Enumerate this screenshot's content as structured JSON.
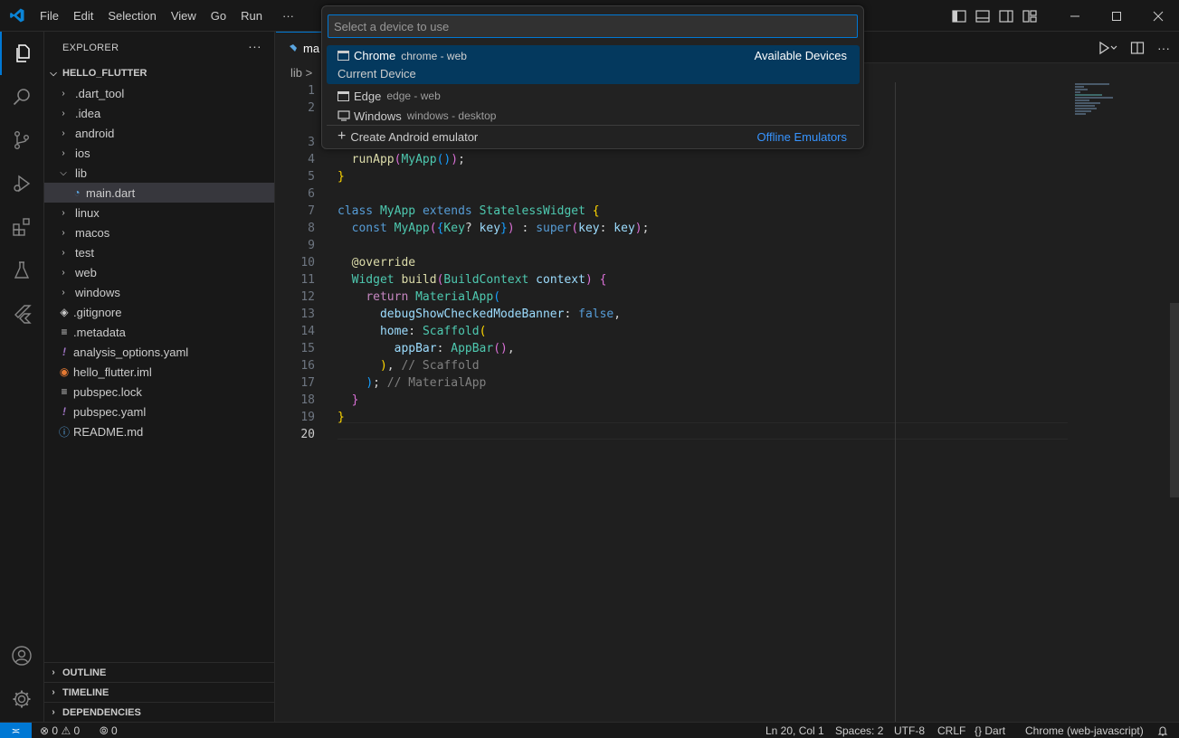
{
  "menu": [
    "File",
    "Edit",
    "Selection",
    "View",
    "Go",
    "Run",
    "···"
  ],
  "explorer": {
    "title": "EXPLORER",
    "more": "···",
    "project": "HELLO_FLUTTER",
    "items": [
      {
        "label": ".dart_tool",
        "kind": "folder"
      },
      {
        "label": ".idea",
        "kind": "folder"
      },
      {
        "label": "android",
        "kind": "folder"
      },
      {
        "label": "ios",
        "kind": "folder"
      },
      {
        "label": "lib",
        "kind": "folder-open"
      },
      {
        "label": "main.dart",
        "kind": "dart"
      },
      {
        "label": "linux",
        "kind": "folder"
      },
      {
        "label": "macos",
        "kind": "folder"
      },
      {
        "label": "test",
        "kind": "folder"
      },
      {
        "label": "web",
        "kind": "folder"
      },
      {
        "label": "windows",
        "kind": "folder"
      },
      {
        "label": ".gitignore",
        "kind": "git"
      },
      {
        "label": ".metadata",
        "kind": "lines"
      },
      {
        "label": "analysis_options.yaml",
        "kind": "yaml"
      },
      {
        "label": "hello_flutter.iml",
        "kind": "rss"
      },
      {
        "label": "pubspec.lock",
        "kind": "lines"
      },
      {
        "label": "pubspec.yaml",
        "kind": "yaml"
      },
      {
        "label": "README.md",
        "kind": "info"
      }
    ],
    "sections": [
      "OUTLINE",
      "TIMELINE",
      "DEPENDENCIES"
    ]
  },
  "editor": {
    "tab_label": "ma",
    "breadcrumb": "lib >",
    "line_numbers": [
      "1",
      "2",
      "3",
      "4",
      "5",
      "6",
      "7",
      "8",
      "9",
      "10",
      "11",
      "12",
      "13",
      "14",
      "15",
      "16",
      "17",
      "18",
      "19",
      "20"
    ]
  },
  "quickpick": {
    "placeholder": "Select a device to use",
    "items": [
      {
        "label": "Chrome",
        "desc": "chrome - web",
        "right": "Available Devices",
        "sub": "Current Device"
      },
      {
        "label": "Edge",
        "desc": "edge - web"
      },
      {
        "label": "Windows",
        "desc": "windows - desktop"
      },
      {
        "label": "Create Android emulator",
        "right": "Offline Emulators"
      }
    ],
    "colors": {
      "selected": "#04395e",
      "link": "#3794ff"
    }
  },
  "status": {
    "errors": "0",
    "warnings": "0",
    "ports": "0",
    "position": "Ln 20, Col 1",
    "spaces": "Spaces: 2",
    "encoding": "UTF-8",
    "eol": "CRLF",
    "language": "Dart",
    "device": "Chrome (web-javascript)"
  },
  "colors": {
    "accent": "#0078d4",
    "background": "#1f1f1f",
    "sidebar": "#181818"
  }
}
